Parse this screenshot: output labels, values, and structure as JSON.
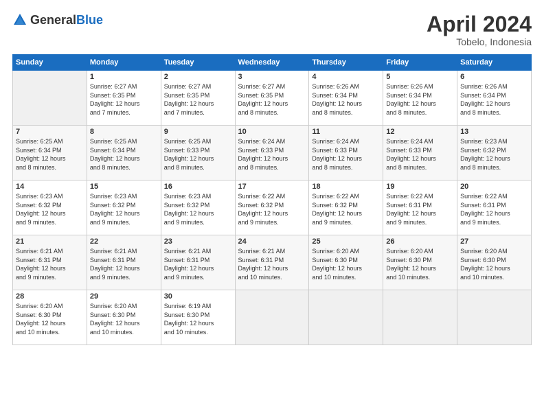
{
  "header": {
    "logo_general": "General",
    "logo_blue": "Blue",
    "title": "April 2024",
    "location": "Tobelo, Indonesia"
  },
  "columns": [
    "Sunday",
    "Monday",
    "Tuesday",
    "Wednesday",
    "Thursday",
    "Friday",
    "Saturday"
  ],
  "weeks": [
    [
      {
        "day": "",
        "info": ""
      },
      {
        "day": "1",
        "info": "Sunrise: 6:27 AM\nSunset: 6:35 PM\nDaylight: 12 hours\nand 7 minutes."
      },
      {
        "day": "2",
        "info": "Sunrise: 6:27 AM\nSunset: 6:35 PM\nDaylight: 12 hours\nand 7 minutes."
      },
      {
        "day": "3",
        "info": "Sunrise: 6:27 AM\nSunset: 6:35 PM\nDaylight: 12 hours\nand 8 minutes."
      },
      {
        "day": "4",
        "info": "Sunrise: 6:26 AM\nSunset: 6:34 PM\nDaylight: 12 hours\nand 8 minutes."
      },
      {
        "day": "5",
        "info": "Sunrise: 6:26 AM\nSunset: 6:34 PM\nDaylight: 12 hours\nand 8 minutes."
      },
      {
        "day": "6",
        "info": "Sunrise: 6:26 AM\nSunset: 6:34 PM\nDaylight: 12 hours\nand 8 minutes."
      }
    ],
    [
      {
        "day": "7",
        "info": "Sunrise: 6:25 AM\nSunset: 6:34 PM\nDaylight: 12 hours\nand 8 minutes."
      },
      {
        "day": "8",
        "info": "Sunrise: 6:25 AM\nSunset: 6:34 PM\nDaylight: 12 hours\nand 8 minutes."
      },
      {
        "day": "9",
        "info": "Sunrise: 6:25 AM\nSunset: 6:33 PM\nDaylight: 12 hours\nand 8 minutes."
      },
      {
        "day": "10",
        "info": "Sunrise: 6:24 AM\nSunset: 6:33 PM\nDaylight: 12 hours\nand 8 minutes."
      },
      {
        "day": "11",
        "info": "Sunrise: 6:24 AM\nSunset: 6:33 PM\nDaylight: 12 hours\nand 8 minutes."
      },
      {
        "day": "12",
        "info": "Sunrise: 6:24 AM\nSunset: 6:33 PM\nDaylight: 12 hours\nand 8 minutes."
      },
      {
        "day": "13",
        "info": "Sunrise: 6:23 AM\nSunset: 6:32 PM\nDaylight: 12 hours\nand 8 minutes."
      }
    ],
    [
      {
        "day": "14",
        "info": "Sunrise: 6:23 AM\nSunset: 6:32 PM\nDaylight: 12 hours\nand 9 minutes."
      },
      {
        "day": "15",
        "info": "Sunrise: 6:23 AM\nSunset: 6:32 PM\nDaylight: 12 hours\nand 9 minutes."
      },
      {
        "day": "16",
        "info": "Sunrise: 6:23 AM\nSunset: 6:32 PM\nDaylight: 12 hours\nand 9 minutes."
      },
      {
        "day": "17",
        "info": "Sunrise: 6:22 AM\nSunset: 6:32 PM\nDaylight: 12 hours\nand 9 minutes."
      },
      {
        "day": "18",
        "info": "Sunrise: 6:22 AM\nSunset: 6:32 PM\nDaylight: 12 hours\nand 9 minutes."
      },
      {
        "day": "19",
        "info": "Sunrise: 6:22 AM\nSunset: 6:31 PM\nDaylight: 12 hours\nand 9 minutes."
      },
      {
        "day": "20",
        "info": "Sunrise: 6:22 AM\nSunset: 6:31 PM\nDaylight: 12 hours\nand 9 minutes."
      }
    ],
    [
      {
        "day": "21",
        "info": "Sunrise: 6:21 AM\nSunset: 6:31 PM\nDaylight: 12 hours\nand 9 minutes."
      },
      {
        "day": "22",
        "info": "Sunrise: 6:21 AM\nSunset: 6:31 PM\nDaylight: 12 hours\nand 9 minutes."
      },
      {
        "day": "23",
        "info": "Sunrise: 6:21 AM\nSunset: 6:31 PM\nDaylight: 12 hours\nand 9 minutes."
      },
      {
        "day": "24",
        "info": "Sunrise: 6:21 AM\nSunset: 6:31 PM\nDaylight: 12 hours\nand 10 minutes."
      },
      {
        "day": "25",
        "info": "Sunrise: 6:20 AM\nSunset: 6:30 PM\nDaylight: 12 hours\nand 10 minutes."
      },
      {
        "day": "26",
        "info": "Sunrise: 6:20 AM\nSunset: 6:30 PM\nDaylight: 12 hours\nand 10 minutes."
      },
      {
        "day": "27",
        "info": "Sunrise: 6:20 AM\nSunset: 6:30 PM\nDaylight: 12 hours\nand 10 minutes."
      }
    ],
    [
      {
        "day": "28",
        "info": "Sunrise: 6:20 AM\nSunset: 6:30 PM\nDaylight: 12 hours\nand 10 minutes."
      },
      {
        "day": "29",
        "info": "Sunrise: 6:20 AM\nSunset: 6:30 PM\nDaylight: 12 hours\nand 10 minutes."
      },
      {
        "day": "30",
        "info": "Sunrise: 6:19 AM\nSunset: 6:30 PM\nDaylight: 12 hours\nand 10 minutes."
      },
      {
        "day": "",
        "info": ""
      },
      {
        "day": "",
        "info": ""
      },
      {
        "day": "",
        "info": ""
      },
      {
        "day": "",
        "info": ""
      }
    ]
  ]
}
